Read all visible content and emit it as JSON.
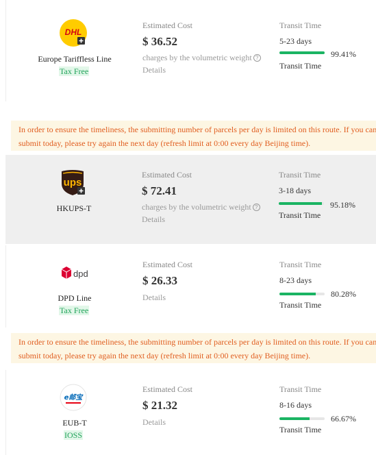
{
  "labels": {
    "estimated_cost": "Estimated Cost",
    "transit_time": "Transit Time",
    "details": "Details",
    "volumetric": "charges by the volumetric weight",
    "help_glyph": "?"
  },
  "notice_text": "In order to ensure the timeliness, the submitting number of parcels per day is limited on this route. If you can't submit today, please try again the next day (refresh limit at 0:00 every day Beijing time).",
  "routes": [
    {
      "name": "Europe Tariffless Line",
      "badge": "Tax Free",
      "price": "$ 36.52",
      "days": "5-23 days",
      "percent": "99.41%",
      "progress": 0.9941,
      "logo": "dhl-logo"
    },
    {
      "name": "HKUPS-T",
      "badge": "",
      "price": "$ 72.41",
      "days": "3-18 days",
      "percent": "95.18%",
      "progress": 0.9518,
      "logo": "ups-logo"
    },
    {
      "name": "DPD Line",
      "badge": "Tax Free",
      "price": "$ 26.33",
      "days": "8-23 days",
      "percent": "80.28%",
      "progress": 0.8028,
      "logo": "dpd-logo"
    },
    {
      "name": "EUB-T",
      "badge": "IOSS",
      "price": "$ 21.32",
      "days": "8-16 days",
      "percent": "66.67%",
      "progress": 0.6667,
      "logo": "eub-logo"
    }
  ],
  "logos": {
    "dhl_text": "DHL",
    "ups_text": "ups",
    "dpd_text": "dpd",
    "eub_text": "e邮宝"
  },
  "colors": {
    "progress_fill": "#1bb463",
    "badge_text": "#21a35a",
    "notice_text": "#e05d1f",
    "notice_bg": "#fdf6e3",
    "dhl_yellow": "#ffcc00",
    "dhl_red": "#d40511",
    "ups_brown": "#351c15",
    "ups_gold": "#ffb500",
    "dpd_red": "#dc0032"
  }
}
